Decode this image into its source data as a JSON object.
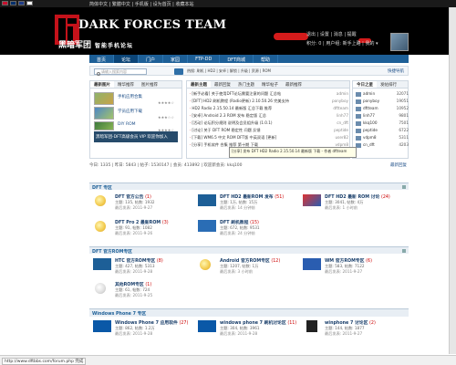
{
  "topbar": {
    "flags": [
      "flag-cn",
      "flag-tw",
      "flag-uk",
      "flag-jp"
    ],
    "links": "简体中文 | 繁體中文 | 手机版 | 设为首页 | 收藏本站"
  },
  "header": {
    "logo_title": "DARK FORCES TEAM",
    "logo_cn": "黑暗军团",
    "logo_tagline": "智能手机论坛",
    "user_links_1": "退出 | 设置 | 消息 | 提醒",
    "user_links_2": "积分: 0 | 用户组: 新手上路 | 我的 ▾"
  },
  "nav": {
    "items": [
      "首页",
      "论坛",
      "门户",
      "家园",
      "FTP-DD",
      "DFT商城",
      "帮助"
    ],
    "active_index": 1
  },
  "search": {
    "placeholder": "请输入搜索内容",
    "hot_label": "热搜: 刷机 | HD2 | 安卓 | 解锁 | 升级 | 资源 | ROM",
    "right_links": "快捷导航"
  },
  "left_panel": {
    "tabs": [
      "最新图片",
      "精华推荐",
      "图片推荐"
    ],
    "items": [
      {
        "label": "手机应用合集",
        "meta": "★★★★☆"
      },
      {
        "label": "学员应用下载",
        "meta": "★★★☆☆"
      },
      {
        "label": "DIY ROM",
        "meta": "★★★★☆"
      }
    ],
    "slide_caption": "黑暗军团-DFT高级会员 VIP 欢迎你加入"
  },
  "center_panel": {
    "tabs": [
      "最新主题",
      "最新回复",
      "热门主题",
      "精华帖子",
      "最新推荐"
    ],
    "rows": [
      {
        "text": "[新手必看] 关于使用DFT论坛需要注意的问题 汇总帖",
        "author": "admin"
      },
      {
        "text": "[DFT] HD2 刷机教程 (Radio更新) 2.10.50.26 完美支持",
        "author": "ponyboy"
      },
      {
        "text": "HD2 Radio 2.15.50.14 最新版 汇总下载 推荐",
        "author": "dftteam"
      },
      {
        "text": "[安卓] Android 2.3 ROM 发布 稳定版 汇总",
        "author": "linh77"
      },
      {
        "text": "[活动] 论坛积分规则 说明及会员组升级 (1.0.1)",
        "author": "cn_dft"
      },
      {
        "text": "[讨论] 关于 DFT ROM 稳定性 问题 反馈",
        "author": "peptide"
      },
      {
        "text": "[下载] WM6.5 中文 ROM DFT版 中英双语 [更新]",
        "author": "user82"
      },
      {
        "text": "[分享] 手机软件 合集 推荐 第十期 下载",
        "author": "vdpm8"
      }
    ]
  },
  "right_panel": {
    "tabs": [
      "今日之星",
      "发帖排行"
    ],
    "rows": [
      {
        "name": "admin",
        "num": "32071"
      },
      {
        "name": "ponyboy",
        "num": "19051"
      },
      {
        "name": "dftteam",
        "num": "10952"
      },
      {
        "name": "linh77",
        "num": "9801"
      },
      {
        "name": "kkq100",
        "num": "7501"
      },
      {
        "name": "peptide",
        "num": "6722"
      },
      {
        "name": "vdpm8",
        "num": "5311"
      },
      {
        "name": "cn_dft",
        "num": "4203"
      }
    ]
  },
  "tooltip": {
    "text": "[分享] 发布 DFT HD2 Radio 2.15.50.14 最新版 下载 - 作者 dftteam"
  },
  "stats": {
    "text": "今日: 1335 | 昨日: 5843 | 帖子: 1530147 | 会员: 413892 | 欢迎新会员: kkq100",
    "right": "最新回复"
  },
  "sections": [
    {
      "title": "DFT 专区",
      "forums": [
        {
          "name": "DFT 官方公告",
          "new": "(1)",
          "stat": "主题: 135, 帖数: 1932",
          "last": "最后发表: 2011-9-27"
        },
        {
          "name": "DFT HD2 最新ROM 发布",
          "new": "(51)",
          "stat": "主题: 1万, 帖数: 15万",
          "last": "最后发表: 14 分钟前"
        },
        {
          "name": "DFT HD2 最新 ROM 讨论",
          "new": "(24)",
          "stat": "主题: 3041, 帖数: 4万",
          "last": "最后发表: 1 小时前"
        },
        {
          "name": "DFT Pro 2 最新ROM",
          "new": "(3)",
          "stat": "主题: 91, 帖数: 1082",
          "last": "最后发表: 2011-9-26"
        },
        {
          "name": "DFT 刷机教程",
          "new": "(15)",
          "stat": "主题: 672, 帖数: 9531",
          "last": "最后发表: 24 分钟前"
        }
      ]
    },
    {
      "title": "DFT 官方ROM专区",
      "forums": [
        {
          "name": "HTC 官方ROM专区",
          "new": "(8)",
          "stat": "主题: 427, 帖数: 5313",
          "last": "最后发表: 2011-9-28"
        },
        {
          "name": "Android 官方ROM专区",
          "new": "(12)",
          "stat": "主题: 1207, 帖数: 1万",
          "last": "最后发表: 3 小时前"
        },
        {
          "name": "WM 官方ROM专区",
          "new": "(6)",
          "stat": "主题: 583, 帖数: 7122",
          "last": "最后发表: 2011-9-27"
        },
        {
          "name": "其他ROM专区",
          "new": "(1)",
          "stat": "主题: 61, 帖数: 724",
          "last": "最后发表: 2011-9-25"
        }
      ]
    },
    {
      "title": "Windows Phone 7 专区",
      "forums": [
        {
          "name": "Windows Phone 7 应用软件",
          "new": "(27)",
          "stat": "主题: 862, 帖数: 1.2万",
          "last": "最后发表: 2011-9-28"
        },
        {
          "name": "windows phone 7 刷机讨论区",
          "new": "(11)",
          "stat": "主题: 304, 帖数: 3961",
          "last": "最后发表: 2011-9-28"
        },
        {
          "name": "winphone 7 讨论区",
          "new": "(2)",
          "stat": "主题: 144, 帖数: 1877",
          "last": "最后发表: 2011-9-27"
        }
      ]
    }
  ],
  "statusbar": {
    "text": "http://www.dftbbs.com/forum.php 完成"
  },
  "colors": {
    "nav_bg": "#1d5f97",
    "header_bg": "#000000",
    "accent_red": "#d41b1b"
  }
}
